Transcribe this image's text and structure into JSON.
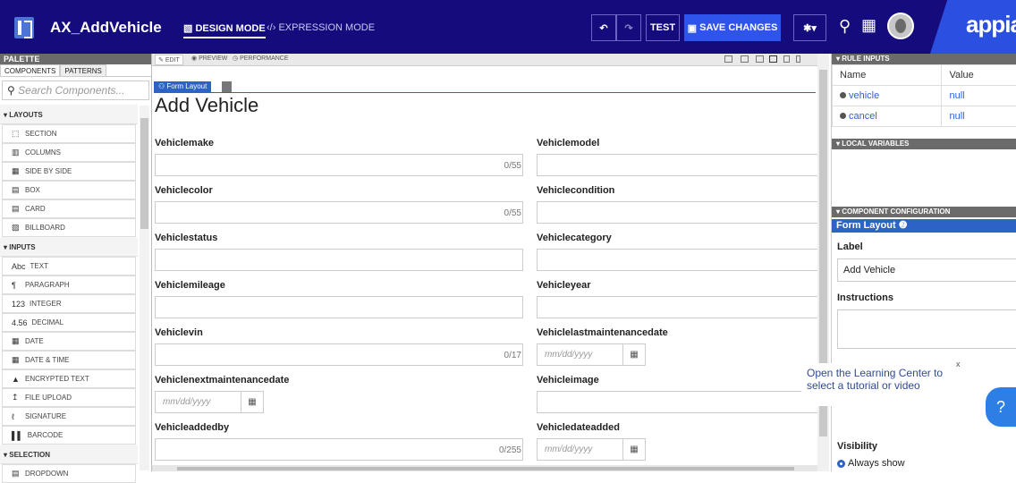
{
  "header": {
    "title": "AX_AddVehicle",
    "design_mode": "DESIGN MODE",
    "expression_mode": "EXPRESSION MODE",
    "test_label": "TEST",
    "save_label": "SAVE CHANGES",
    "logo": "appia"
  },
  "palette": {
    "header": "PALETTE",
    "tabs": [
      "COMPONENTS",
      "PATTERNS"
    ],
    "search_placeholder": "Search Components...",
    "sections": [
      {
        "name": "LAYOUTS",
        "items": [
          {
            "icon": "⬚",
            "label": "SECTION"
          },
          {
            "icon": "▥",
            "label": "COLUMNS"
          },
          {
            "icon": "▦",
            "label": "SIDE BY SIDE"
          },
          {
            "icon": "▤",
            "label": "BOX"
          },
          {
            "icon": "▤",
            "label": "CARD"
          },
          {
            "icon": "▨",
            "label": "BILLBOARD"
          }
        ]
      },
      {
        "name": "INPUTS",
        "items": [
          {
            "icon": "Abc",
            "label": "TEXT"
          },
          {
            "icon": "¶",
            "label": "PARAGRAPH"
          },
          {
            "icon": "123",
            "label": "INTEGER"
          },
          {
            "icon": "4.56",
            "label": "DECIMAL"
          },
          {
            "icon": "▦",
            "label": "DATE"
          },
          {
            "icon": "▦",
            "label": "DATE & TIME"
          },
          {
            "icon": "▲",
            "label": "ENCRYPTED TEXT"
          },
          {
            "icon": "↥",
            "label": "FILE UPLOAD"
          },
          {
            "icon": "ℓ",
            "label": "SIGNATURE"
          },
          {
            "icon": "▌▌",
            "label": "BARCODE"
          }
        ]
      },
      {
        "name": "SELECTION",
        "items": [
          {
            "icon": "▤",
            "label": "DROPDOWN"
          }
        ]
      }
    ]
  },
  "modebar": {
    "edit": "EDIT",
    "preview": "PREVIEW",
    "performance": "PERFORMANCE"
  },
  "form": {
    "badge": "Form Layout",
    "title": "Add Vehicle",
    "fields": [
      {
        "label": "Vehiclemake",
        "count": "0/55"
      },
      {
        "label": "Vehiclemodel"
      },
      {
        "label": "Vehiclecolor",
        "count": "0/55"
      },
      {
        "label": "Vehiclecondition"
      },
      {
        "label": "Vehiclestatus"
      },
      {
        "label": "Vehiclecategory"
      },
      {
        "label": "Vehiclemileage"
      },
      {
        "label": "Vehicleyear"
      },
      {
        "label": "Vehiclevin",
        "count": "0/17"
      },
      {
        "label": "Vehiclelastmaintenancedate",
        "placeholder": "mm/dd/yyyy"
      },
      {
        "label": "Vehiclenextmaintenancedate",
        "placeholder": "mm/dd/yyyy"
      },
      {
        "label": "Vehicleimage"
      },
      {
        "label": "Vehicleaddedby",
        "count": "0/255"
      },
      {
        "label": "Vehicledateadded",
        "placeholder": "mm/dd/yyyy"
      }
    ]
  },
  "right": {
    "rule_inputs": "RULE INPUTS",
    "cols": [
      "Name",
      "Value"
    ],
    "rows": [
      [
        "vehicle",
        "null"
      ],
      [
        "cancel",
        "null"
      ]
    ],
    "local_vars": "LOCAL VARIABLES",
    "component_config": "COMPONENT CONFIGURATION",
    "config_title": "Form Layout",
    "label_heading": "Label",
    "label_value": "Add Vehicle",
    "instructions_heading": "Instructions",
    "visibility_heading": "Visibility",
    "visibility_value": "Always show"
  },
  "learning": {
    "text": "Open the Learning Center to select a tutorial or video",
    "close": "x",
    "help": "?"
  }
}
